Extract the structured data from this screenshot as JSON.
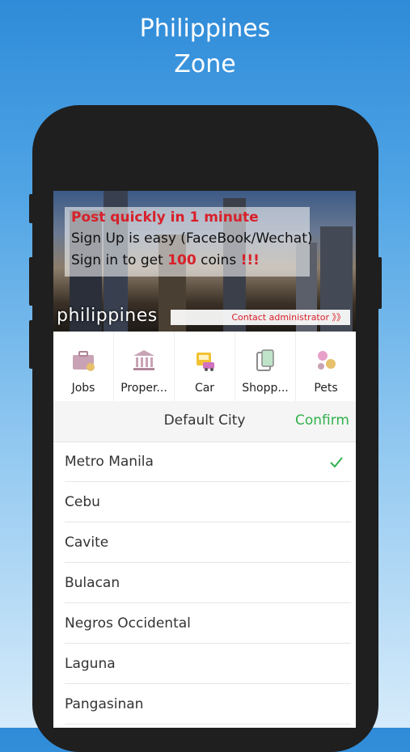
{
  "promo": {
    "title_line1": "Philippines",
    "title_line2": "Zone"
  },
  "banner": {
    "line1": "Post quickly in 1 minute",
    "line2": "Sign Up is easy (FaceBook/Wechat)",
    "line3_prefix": "Sign in to get ",
    "line3_highlight": "100",
    "line3_middle": " coins ",
    "line3_suffix": "!!!",
    "city_text": "philippines",
    "contact_label": "Contact administrator 》》"
  },
  "categories": [
    {
      "label": "Jobs",
      "icon": "briefcase-icon"
    },
    {
      "label": "Proper...",
      "icon": "bank-icon"
    },
    {
      "label": "Car",
      "icon": "car-icon"
    },
    {
      "label": "Shopp...",
      "icon": "shopping-icon"
    },
    {
      "label": "Pets",
      "icon": "pets-icon"
    }
  ],
  "picker": {
    "title": "Default City",
    "confirm_label": "Confirm"
  },
  "cities": [
    {
      "label": "Metro Manila",
      "selected": true
    },
    {
      "label": "Cebu"
    },
    {
      "label": "Cavite"
    },
    {
      "label": "Bulacan"
    },
    {
      "label": "Negros Occidental"
    },
    {
      "label": "Laguna"
    },
    {
      "label": "Pangasinan"
    }
  ],
  "colors": {
    "accent_green": "#31b14c",
    "banner_red": "#d8202a",
    "phone_frame": "#1f1f1f"
  }
}
